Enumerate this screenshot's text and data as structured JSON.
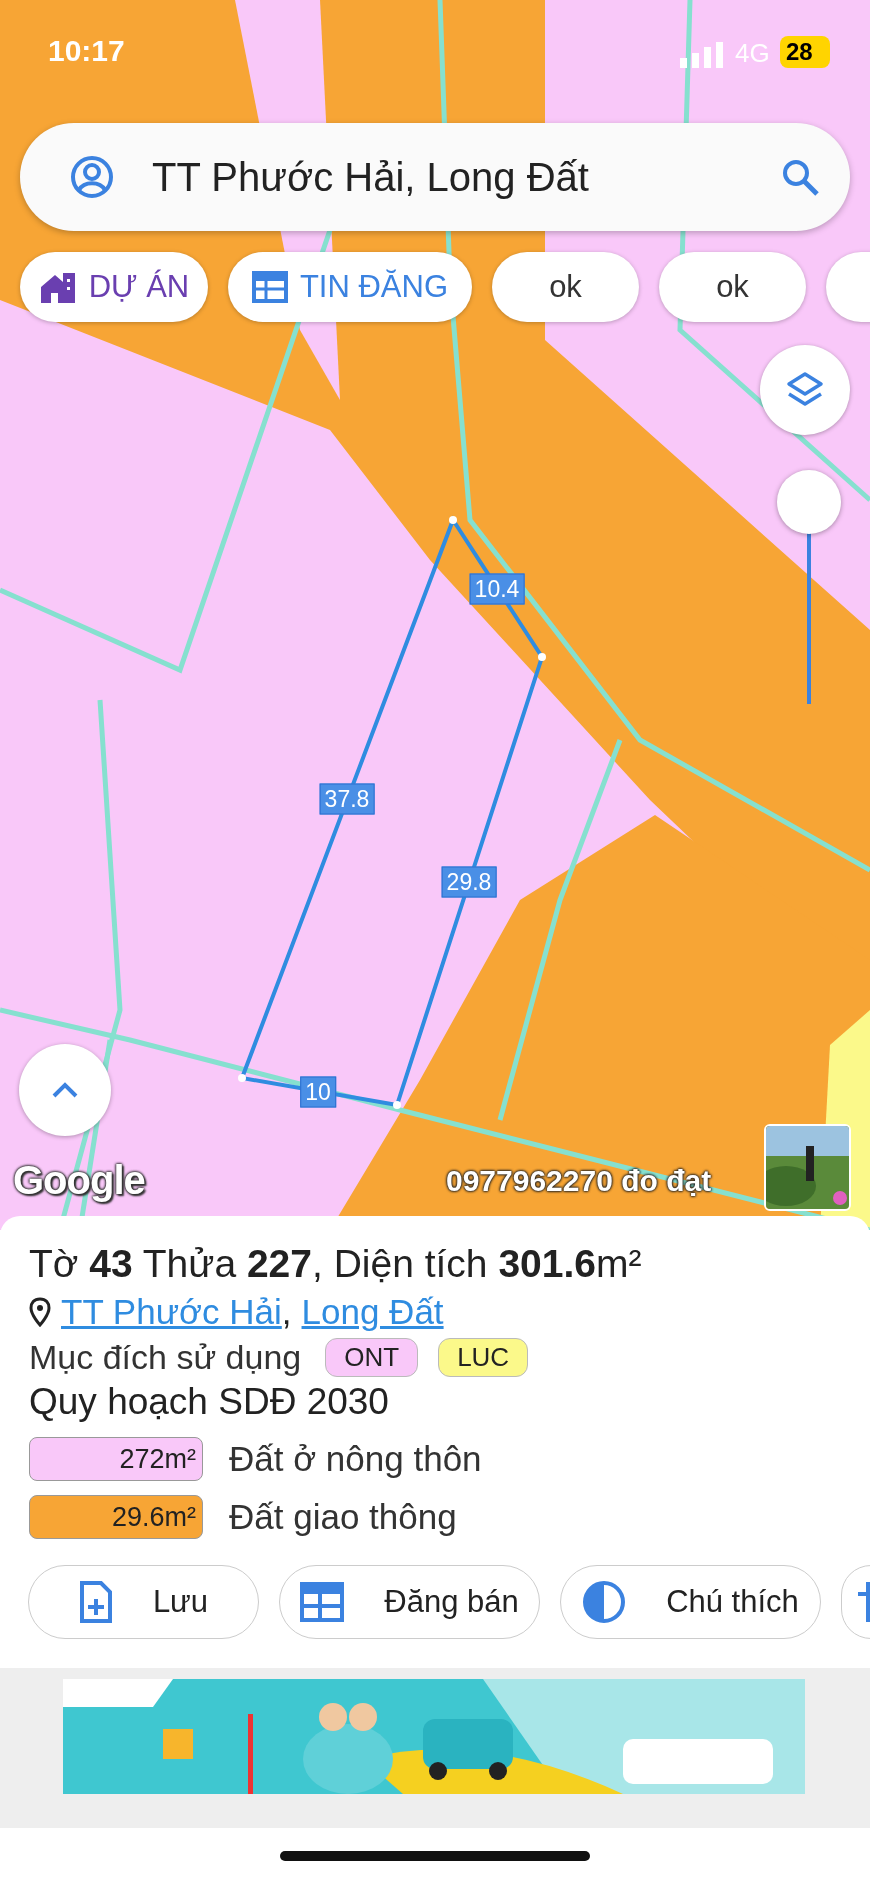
{
  "status_bar": {
    "time": "10:17",
    "network": "4G",
    "battery": "28"
  },
  "search": {
    "value": "TT Phước Hải, Long Đất"
  },
  "chips": [
    {
      "kind": "project",
      "label": "DỰ ÁN"
    },
    {
      "kind": "listing",
      "label": "TIN ĐĂNG"
    },
    {
      "kind": "plain",
      "label": "ok"
    },
    {
      "kind": "plain",
      "label": "ok"
    },
    {
      "kind": "empty"
    }
  ],
  "map": {
    "edge_labels": [
      "10.4",
      "37.8",
      "29.8",
      "10"
    ],
    "attribution": "Google",
    "overlay_text": "0977962270 đo đạt",
    "zoom": {
      "level": 1
    }
  },
  "parcel": {
    "title": "Tờ **43** Thửa **227**, Diện tích **301.6**m²",
    "location": [
      {
        "label": "TT Phước Hải"
      },
      {
        "label": "Long Đất"
      }
    ],
    "separator": ",",
    "usage": {
      "label": "Mục đích sử dụng",
      "tags": [
        {
          "label": "ONT",
          "color": "#f9c8f9"
        },
        {
          "label": "LUC",
          "color": "#fbf98a"
        }
      ]
    },
    "planning": {
      "title": "Quy hoạch SDĐ 2030",
      "rows": [
        {
          "area": "272m²",
          "label": "Đất ở nông thôn",
          "color": "#f9c8f9"
        },
        {
          "area": "29.6m²",
          "label": "Đất giao thông",
          "color": "#f7a535"
        }
      ]
    }
  },
  "actions": [
    {
      "kind": "save",
      "label": "Lưu"
    },
    {
      "kind": "post",
      "label": "Đăng bán"
    },
    {
      "kind": "legend",
      "label": "Chú thích"
    },
    {
      "kind": "more"
    }
  ]
}
